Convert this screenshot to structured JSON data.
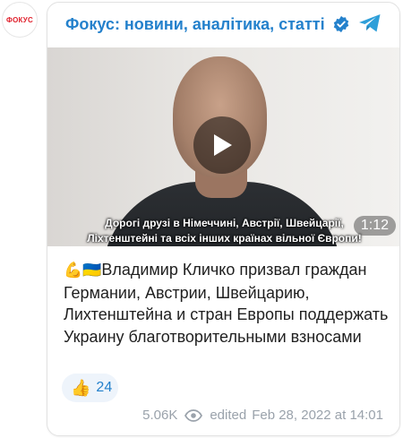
{
  "avatar": {
    "logo_text": "ФОКУС"
  },
  "header": {
    "channel_title": "Фокус: новини, аналітика, статті"
  },
  "video": {
    "subtitle_line1": "Дорогі друзі в Німеччині, Австрії, Швейцарії,",
    "subtitle_line2": "Ліхтенштейні та всіх інших країнах вільної Європи!",
    "duration": "1:12"
  },
  "post": {
    "emoji": "💪🇺🇦",
    "text": "Владимир Кличко призвал граждан Германии, Австрии, Швейцарию, Лихтенштейна и стран Европы поддержать Украину благотворительными взносами"
  },
  "reaction": {
    "emoji": "👍",
    "count": "24"
  },
  "footer": {
    "views": "5.06K",
    "edited_label": "edited",
    "date": "Feb 28, 2022 at 14:01"
  },
  "colors": {
    "accent": "#2481cc",
    "muted": "#9aa2ab",
    "logo_red": "#e0202c"
  }
}
